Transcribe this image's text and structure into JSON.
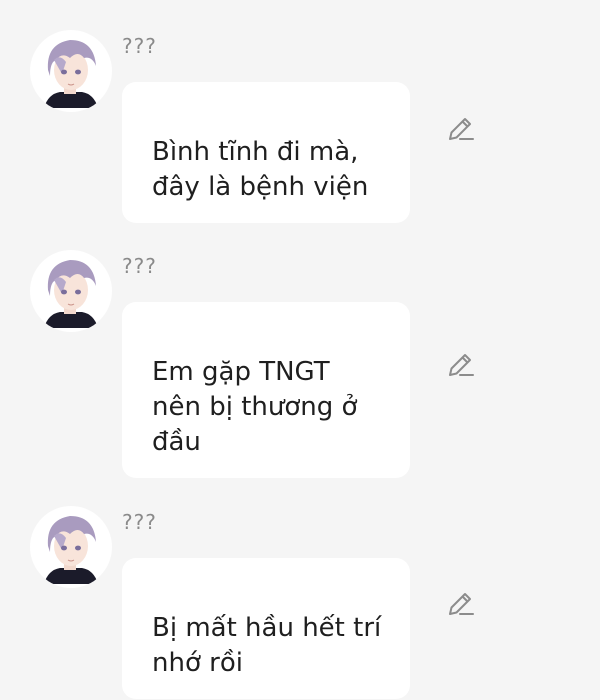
{
  "messages": [
    {
      "sender": "???",
      "text": "Bình tĩnh đi mà,\nđây là bệnh viện",
      "icon": "pencil-edit-icon"
    },
    {
      "sender": "???",
      "text": "Em gặp TNGT\nnên bị thương ở\nđầu",
      "icon": "pencil-edit-icon"
    },
    {
      "sender": "???",
      "text": "Bị mất hầu hết trí\nnhớ rồi",
      "icon": "pencil-edit-icon"
    }
  ],
  "colors": {
    "background": "#f5f5f5",
    "bubble": "#ffffff",
    "text": "#1f1f1f",
    "sender": "#8a8a8a",
    "hair": "#a99bbf",
    "icon": "#8c8c8c"
  }
}
